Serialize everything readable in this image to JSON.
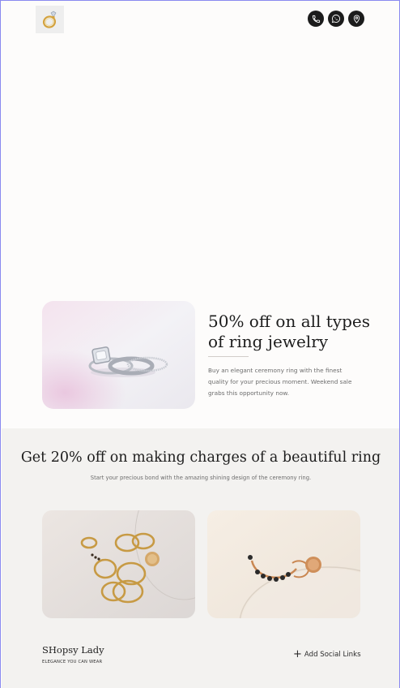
{
  "header": {
    "logo_icon": "ring-logo-icon",
    "contact_icons": [
      "phone-icon",
      "whatsapp-icon",
      "location-pin-icon"
    ]
  },
  "promo": {
    "title": "50% off on all types of ring jewelry",
    "description": "Buy an elegant ceremony ring with the finest quality for your precious moment. Weekend sale grabs this opportunity now."
  },
  "making_charges": {
    "title": "Get 20% off on making charges of a beautiful ring",
    "subtitle": "Start your precious bond with the amazing shining design of the ceremony ring."
  },
  "footer": {
    "brand": "SHopsy Lady",
    "tagline": "ELEGANCE YOU CAN WEAR",
    "social_link_label": "Add Social Links",
    "social_link_icon": "plus-icon"
  },
  "colors": {
    "page_bg": "#fdfcfb",
    "section_bg": "#f3f2f0",
    "icon_bg": "#1c1c1c",
    "text": "#1d1d1d",
    "muted_text": "#6c6c6c",
    "frame_border": "#8a8af0"
  }
}
